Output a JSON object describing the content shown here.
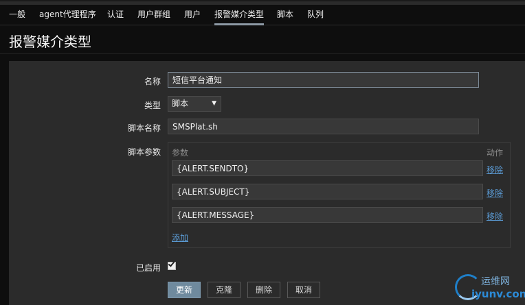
{
  "nav": {
    "tabs": [
      {
        "label": "一般"
      },
      {
        "label": "agent代理程序"
      },
      {
        "label": "认证"
      },
      {
        "label": "用户群组"
      },
      {
        "label": "用户"
      },
      {
        "label": "报警媒介类型",
        "active": true
      },
      {
        "label": "脚本"
      },
      {
        "label": "队列"
      }
    ]
  },
  "page": {
    "title": "报警媒介类型"
  },
  "form": {
    "name_label": "名称",
    "name_value": "短信平台通知",
    "type_label": "类型",
    "type_value": "脚本",
    "script_name_label": "脚本名称",
    "script_name_value": "SMSPlat.sh",
    "script_params_label": "脚本参数",
    "params_header": "参数",
    "action_header": "动作",
    "params": [
      {
        "value": "{ALERT.SENDTO}",
        "remove_label": "移除"
      },
      {
        "value": "{ALERT.SUBJECT}",
        "remove_label": "移除"
      },
      {
        "value": "{ALERT.MESSAGE}",
        "remove_label": "移除"
      }
    ],
    "add_label": "添加",
    "enabled_label": "已启用",
    "enabled": true
  },
  "buttons": {
    "update": "更新",
    "clone": "克隆",
    "delete": "删除",
    "cancel": "取消"
  },
  "watermark": {
    "cn": "运维网",
    "en": "iyunv.com"
  },
  "colors": {
    "background": "#0e0e0e",
    "panel": "#2b2b2b",
    "link": "#5b9bd5",
    "primary_button": "#6f8a9e"
  }
}
